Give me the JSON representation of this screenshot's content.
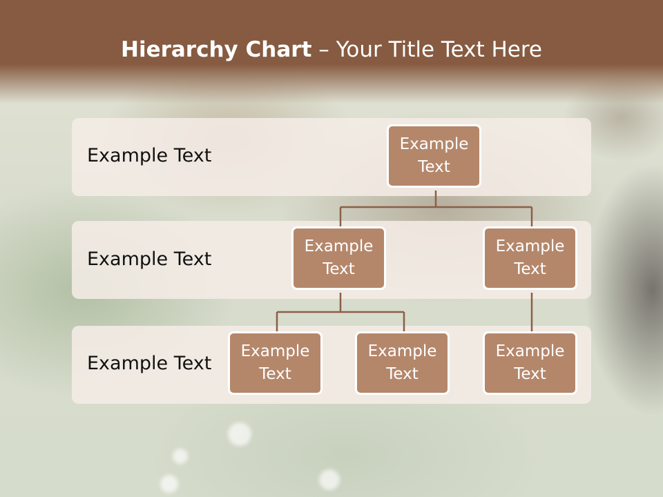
{
  "title": {
    "bold": "Hierarchy Chart",
    "rest": " – Your Title Text Here"
  },
  "bands": [
    {
      "label": "Example Text"
    },
    {
      "label": "Example Text"
    },
    {
      "label": "Example Text"
    }
  ],
  "nodes": {
    "root": "Example Text",
    "level2_left": "Example Text",
    "level2_right": "Example Text",
    "level3_a": "Example Text",
    "level3_b": "Example Text",
    "level3_c": "Example Text"
  },
  "colors": {
    "header": "#865b41",
    "node_fill": "#b4876b",
    "node_border": "#ffffff",
    "band": "#f4ece6",
    "connector": "#8a5f47"
  }
}
